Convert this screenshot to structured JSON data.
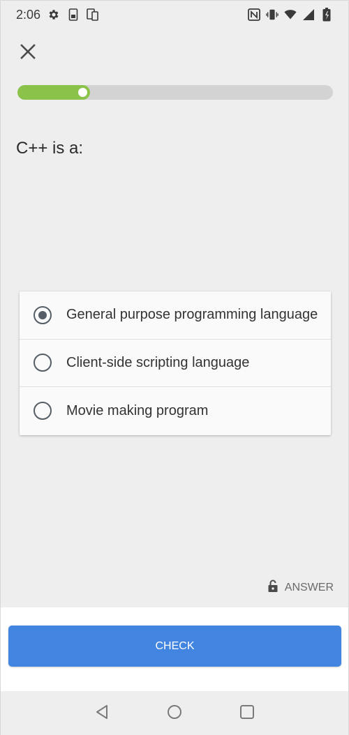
{
  "status_bar": {
    "time": "2:06",
    "icons": [
      "gear-icon",
      "sim-icon",
      "devices-icon",
      "nfc-icon",
      "vibrate-icon",
      "wifi-icon",
      "signal-icon",
      "battery-icon"
    ]
  },
  "header": {
    "close_icon": "close-icon"
  },
  "progress": {
    "fraction": 0.23,
    "fill_color": "#8bc34a",
    "track_color": "#d3d3d3"
  },
  "question": {
    "text": "C++ is a:"
  },
  "options": [
    {
      "label": "General purpose programming language",
      "selected": true
    },
    {
      "label": "Client-side scripting language",
      "selected": false
    },
    {
      "label": "Movie making program",
      "selected": false
    }
  ],
  "answer_link": {
    "label": "ANSWER",
    "icon": "lock-icon"
  },
  "check_button": {
    "label": "CHECK",
    "color": "#4285e0"
  },
  "nav_bar": {
    "icons": [
      "back-icon",
      "home-icon",
      "recents-icon"
    ]
  }
}
